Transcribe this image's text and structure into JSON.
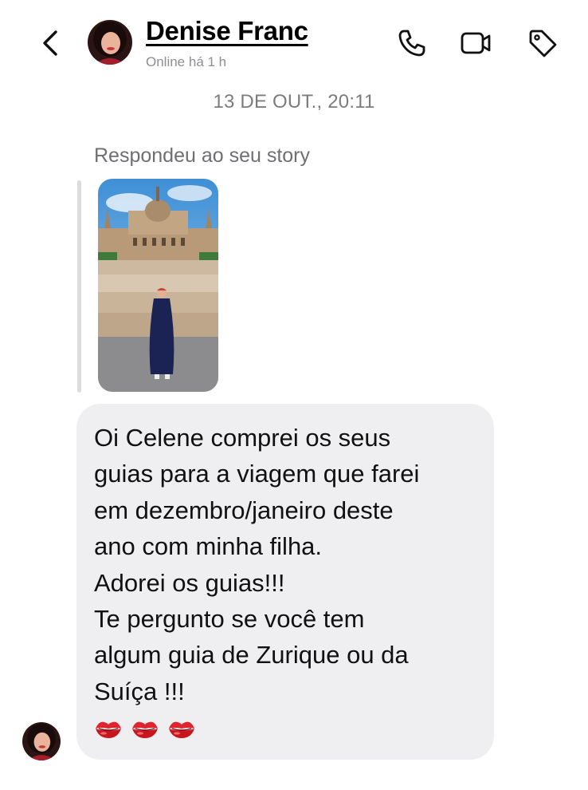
{
  "header": {
    "contact_name": "Denise Franc",
    "status": "Online há 1 h",
    "icons": {
      "back": "chevron-left-icon",
      "call": "phone-icon",
      "video": "video-camera-icon",
      "tag": "tag-icon"
    }
  },
  "conversation": {
    "timestamp": "13 DE OUT., 20:11",
    "story_reply_label": "Respondeu ao seu story",
    "message_lines": [
      "Oi Celene comprei os seus",
      "guias para a viagem que farei",
      "em dezembro/janeiro deste",
      "ano com minha filha.",
      "Adorei os guias!!!",
      "Te pergunto se você tem",
      "algum guia de Zurique ou da",
      "Suíça !!!"
    ],
    "emoji_line": [
      "kiss-mark-icon",
      "kiss-mark-icon",
      "kiss-mark-icon"
    ]
  },
  "colors": {
    "bubble": "#efeff1",
    "secondary_text": "#8e8e93",
    "reply_bar": "#dcdcdf",
    "kiss": "#e0242e"
  }
}
